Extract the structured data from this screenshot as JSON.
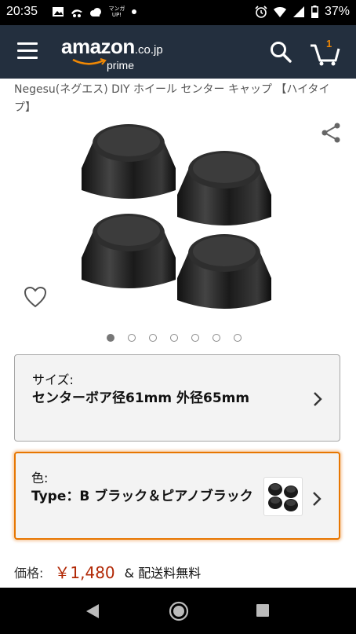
{
  "status_bar": {
    "time": "20:35",
    "battery": "37%",
    "left_icons": [
      "image-icon",
      "app-icon",
      "cloud-icon",
      "manga-app-icon",
      "notification-dot-icon"
    ],
    "manga_label": "マンガ UP!",
    "right_icons": [
      "alarm-icon",
      "wifi-icon",
      "signal-icon",
      "battery-icon"
    ]
  },
  "header": {
    "logo_word": "amazon",
    "logo_tld": ".co.jp",
    "logo_sub": "prime",
    "cart_count": "1",
    "colors": {
      "bar": "#232f3e",
      "accent": "#f08804"
    }
  },
  "product": {
    "title": "Negesu(ネグエス) DIY ホイール センター キャップ 【ハイタイプ】",
    "image_alt": "center caps black",
    "image_count": 7,
    "active_image_index": 0
  },
  "size_selector": {
    "label": "サイズ:",
    "value": "センターボア径61mm 外径65mm"
  },
  "color_selector": {
    "label": "色:",
    "value": "Type：B ブラック＆ピアノブラック",
    "highlight_color": "#e77600"
  },
  "price": {
    "label": "価格:",
    "amount": "￥1,480",
    "shipping": "& 配送料無料",
    "price_color": "#b12704"
  },
  "nav_bar": {
    "buttons": [
      "back-icon",
      "home-icon",
      "recent-apps-icon"
    ]
  }
}
